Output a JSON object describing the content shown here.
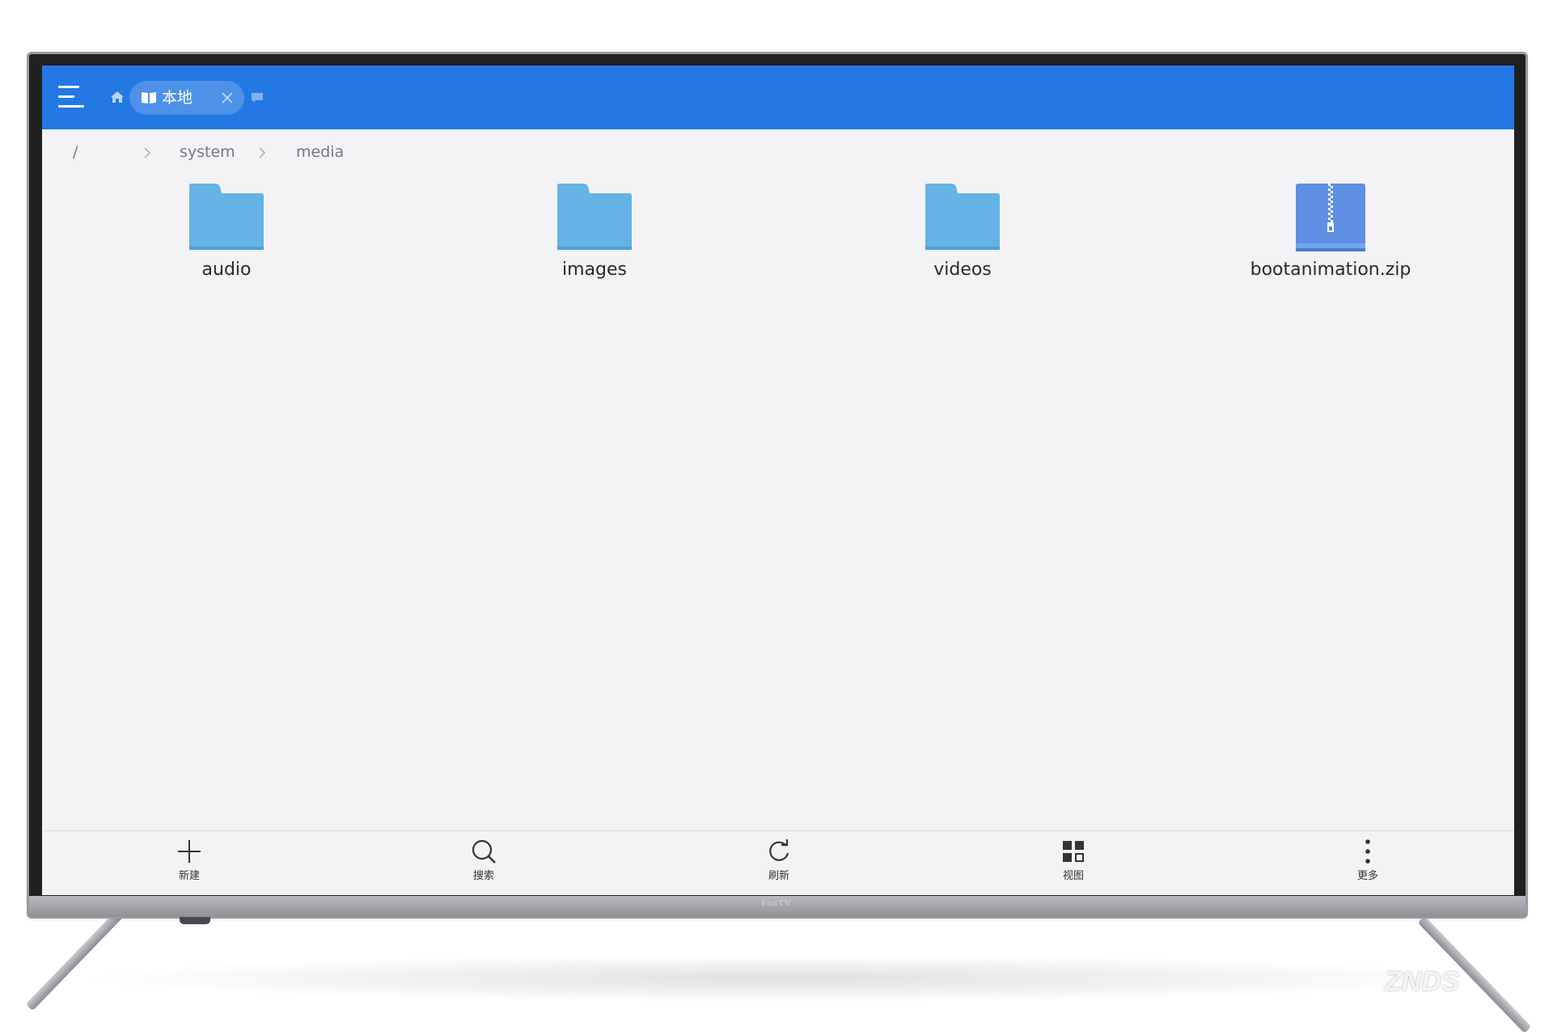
{
  "topbar": {
    "tab_label": "本地"
  },
  "breadcrumb": {
    "root": "/",
    "items": [
      "system",
      "media"
    ]
  },
  "files": [
    {
      "name": "audio",
      "type": "folder"
    },
    {
      "name": "images",
      "type": "folder"
    },
    {
      "name": "videos",
      "type": "folder"
    },
    {
      "name": "bootanimation.zip",
      "type": "zip"
    }
  ],
  "toolbar": {
    "new_label": "新建",
    "search_label": "搜索",
    "refresh_label": "刷新",
    "view_label": "视图",
    "more_label": "更多"
  },
  "tv": {
    "brand": "FunTV"
  },
  "watermark": "ZNDS",
  "colors": {
    "topbar": "#2378e3",
    "folder": "#64b2e6",
    "zip": "#5f8fe3",
    "background": "#f3f3f6"
  }
}
